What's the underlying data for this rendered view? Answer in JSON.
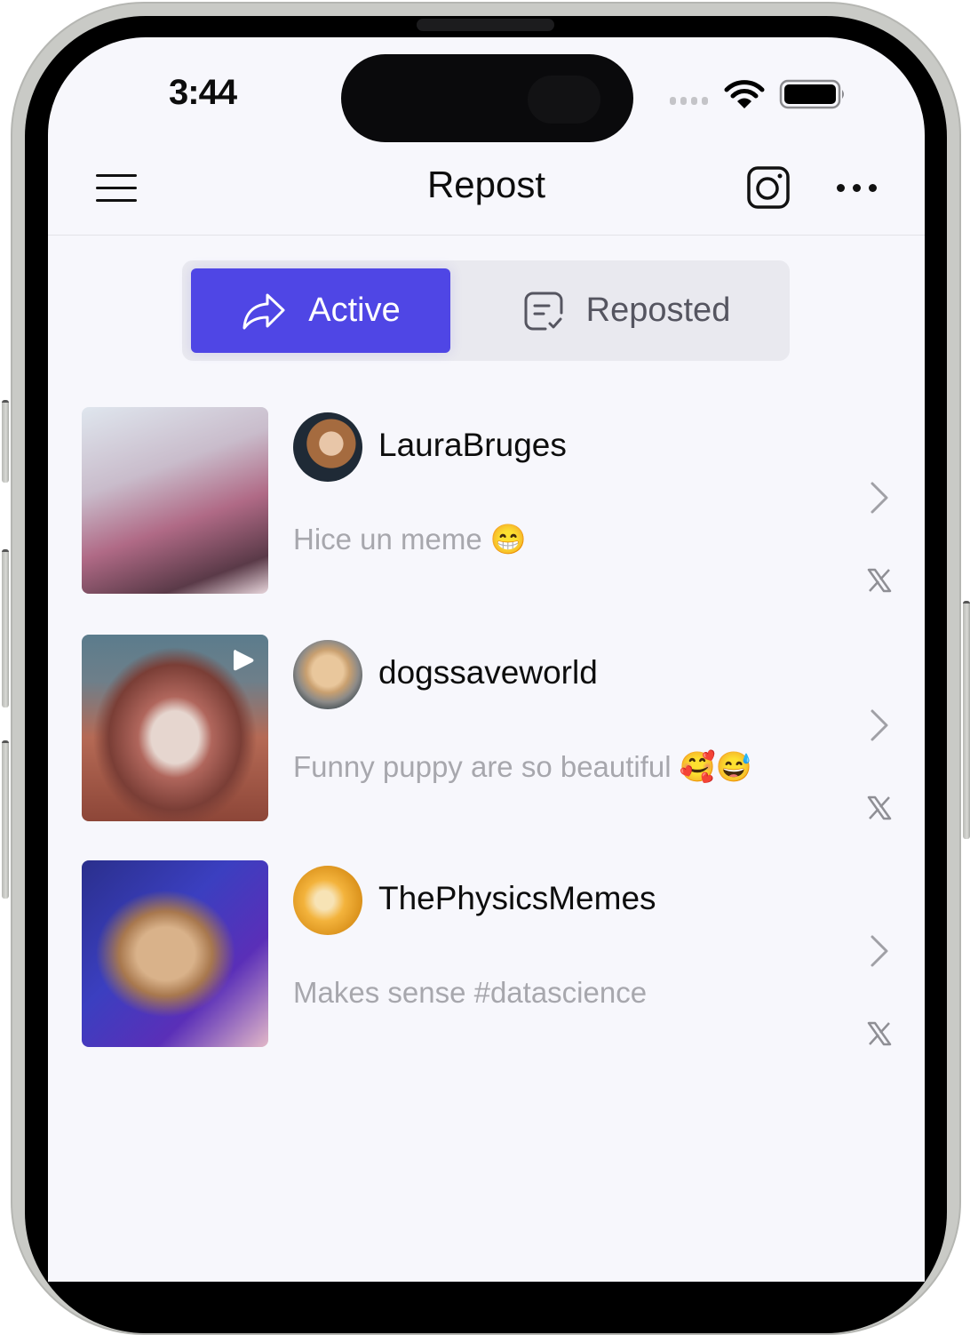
{
  "status_bar": {
    "time": "3:44",
    "icons": [
      "cellular-signal-icon",
      "wifi-icon",
      "battery-icon"
    ]
  },
  "header": {
    "title": "Repost",
    "menu_icon": "hamburger-menu-icon",
    "instagram_icon": "instagram-icon",
    "more_icon": "more-horizontal-icon"
  },
  "tabs": [
    {
      "label": "Active",
      "icon": "share-arrow-icon",
      "selected": true
    },
    {
      "label": "Reposted",
      "icon": "note-check-icon",
      "selected": false
    }
  ],
  "colors": {
    "accent": "#4f46e5",
    "background": "#f7f7fc",
    "caption": "#a7a7ad",
    "text": "#0d0d0d"
  },
  "posts": [
    {
      "username": "LauraBruges",
      "caption": "Hice un meme 😁",
      "is_video": false,
      "platform_icon": "x-logo-icon"
    },
    {
      "username": "dogssaveworld",
      "caption": "Funny puppy are so beautiful 🥰😅",
      "is_video": true,
      "platform_icon": "x-logo-icon"
    },
    {
      "username": "ThePhysicsMemes",
      "caption": "Makes sense #datascience",
      "is_video": false,
      "platform_icon": "x-logo-icon"
    }
  ]
}
